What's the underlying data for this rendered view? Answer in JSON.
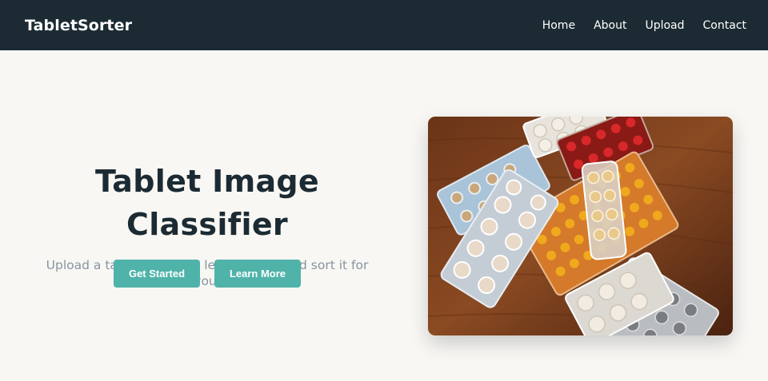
{
  "navbar": {
    "brand": "TabletSorter",
    "links": [
      "Home",
      "About",
      "Upload",
      "Contact"
    ]
  },
  "hero": {
    "title": "Tablet Image Classifier",
    "subtitle": "Upload a tablet image — let AI detect and sort it for you.",
    "buttons": {
      "get_started": "Get Started",
      "learn_more": "Learn More"
    }
  },
  "colors": {
    "nav_bg": "#1c2b33",
    "page_bg": "#f8f7f4",
    "accent": "#4fb3a9",
    "title": "#1c2b33",
    "subtitle": "#8794a0"
  }
}
